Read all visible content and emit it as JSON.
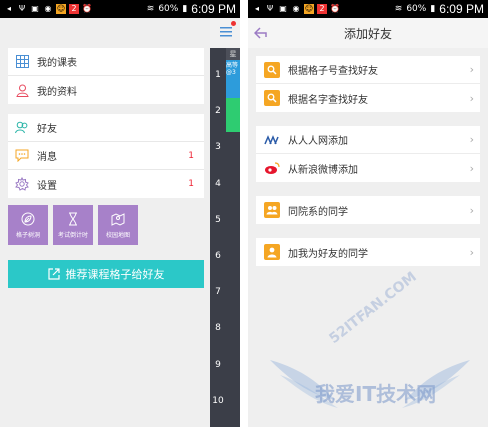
{
  "status_bar": {
    "time": "6:09 PM",
    "battery": "60%"
  },
  "left": {
    "menu_group1": [
      {
        "label": "我的课表",
        "icon": "grid-icon"
      },
      {
        "label": "我的资料",
        "icon": "person-icon"
      }
    ],
    "menu_group2": [
      {
        "label": "好友",
        "icon": "friends-icon",
        "badge": ""
      },
      {
        "label": "消息",
        "icon": "message-icon",
        "badge": "1"
      },
      {
        "label": "设置",
        "icon": "gear-icon",
        "badge": "1"
      }
    ],
    "tiles": [
      {
        "label": "格子树洞",
        "icon": "leaf-icon"
      },
      {
        "label": "考试倒计时",
        "icon": "hourglass-icon"
      },
      {
        "label": "校园地图",
        "icon": "map-icon"
      }
    ],
    "recommend_label": "推荐课程格子给好友",
    "schedule": {
      "rows": [
        "1",
        "2",
        "3",
        "4",
        "5",
        "6",
        "7",
        "8",
        "9",
        "10"
      ],
      "header_fragment": "星",
      "course_fragment": "高等\n@3",
      "colors": {
        "blue": "#2d9cdb",
        "green": "#2ecc71",
        "dark": "#3b3e48"
      }
    }
  },
  "right": {
    "title": "添加好友",
    "groups": [
      [
        {
          "label": "根据格子号查找好友",
          "icon": "search-icon",
          "color": "#f5a623"
        },
        {
          "label": "根据名字查找好友",
          "icon": "search-icon",
          "color": "#f5a623"
        }
      ],
      [
        {
          "label": "从人人网添加",
          "icon": "renren-icon",
          "color": "#ffffff"
        },
        {
          "label": "从新浪微博添加",
          "icon": "weibo-icon",
          "color": "#ffffff"
        }
      ],
      [
        {
          "label": "同院系的同学",
          "icon": "classmates-icon",
          "color": "#f5a623"
        }
      ],
      [
        {
          "label": "加我为好友的同学",
          "icon": "add-user-icon",
          "color": "#f5a623"
        }
      ]
    ]
  },
  "watermark": {
    "text": "我爱IT技术网",
    "url": "52ITFAN.COM"
  }
}
